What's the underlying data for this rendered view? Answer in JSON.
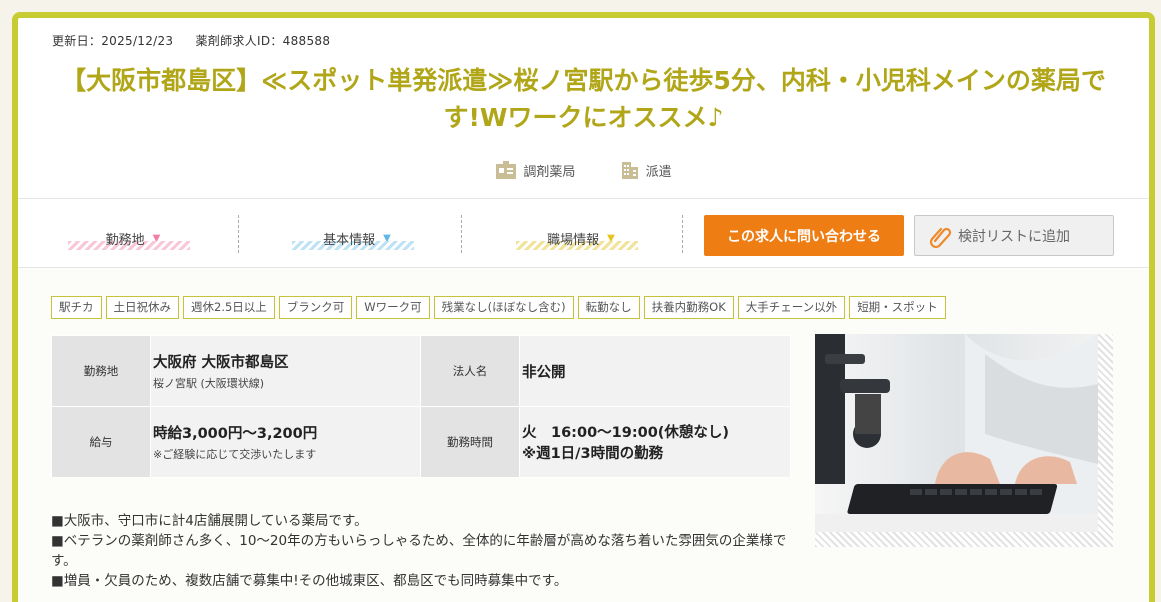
{
  "meta": {
    "updated": "更新日：2025/12/23",
    "job_id": "薬剤師求人ID：488588"
  },
  "title": "【大阪市都島区】≪スポット単発派遣≫桜ノ宮駅から徒歩5分、内科・小児科メインの薬局です!Wワークにオススメ♪",
  "categories": [
    {
      "icon": "pharmacy-icon",
      "label": "調剤薬局"
    },
    {
      "icon": "building-icon",
      "label": "派遣"
    }
  ],
  "tabs": [
    {
      "label": "勤務地",
      "arrow": "▼",
      "color": "#f07fa8"
    },
    {
      "label": "基本情報",
      "arrow": "▼",
      "color": "#5fb8e6"
    },
    {
      "label": "職場情報",
      "arrow": "▼",
      "color": "#e8c41c"
    }
  ],
  "actions": {
    "contact": "この求人に問い合わせる",
    "add_list": "検討リストに追加"
  },
  "tags": [
    "駅チカ",
    "土日祝休み",
    "週休2.5日以上",
    "ブランク可",
    "Wワーク可",
    "残業なし(ほぼなし含む)",
    "転勤なし",
    "扶養内勤務OK",
    "大手チェーン以外",
    "短期・スポット"
  ],
  "info": {
    "location_label": "勤務地",
    "location_main": "大阪府 大阪市都島区",
    "location_sub": "桜ノ宮駅 (大阪環状線)",
    "company_label": "法人名",
    "company_value": "非公開",
    "salary_label": "給与",
    "salary_main": "時給3,000円～3,200円",
    "salary_sub": "※ご経験に応じて交渉いたします",
    "hours_label": "勤務時間",
    "hours_main": "火　16:00～19:00(休憩なし)",
    "hours_sub": "※週1日/3時間の勤務"
  },
  "description": [
    "■大阪市、守口市に計4店舗展開している薬局です。",
    "■ベテランの薬剤師さん多く、10～20年の方もいらっしゃるため、全体的に年齢層が高めな落ち着いた雰囲気の企業様です。",
    "■増員・欠員のため、複数店舗で募集中!その他城東区、都島区でも同時募集中です。"
  ],
  "colors": {
    "accent": "#c8cc33",
    "title": "#b0a618",
    "contact_button": "#ee7d13"
  }
}
